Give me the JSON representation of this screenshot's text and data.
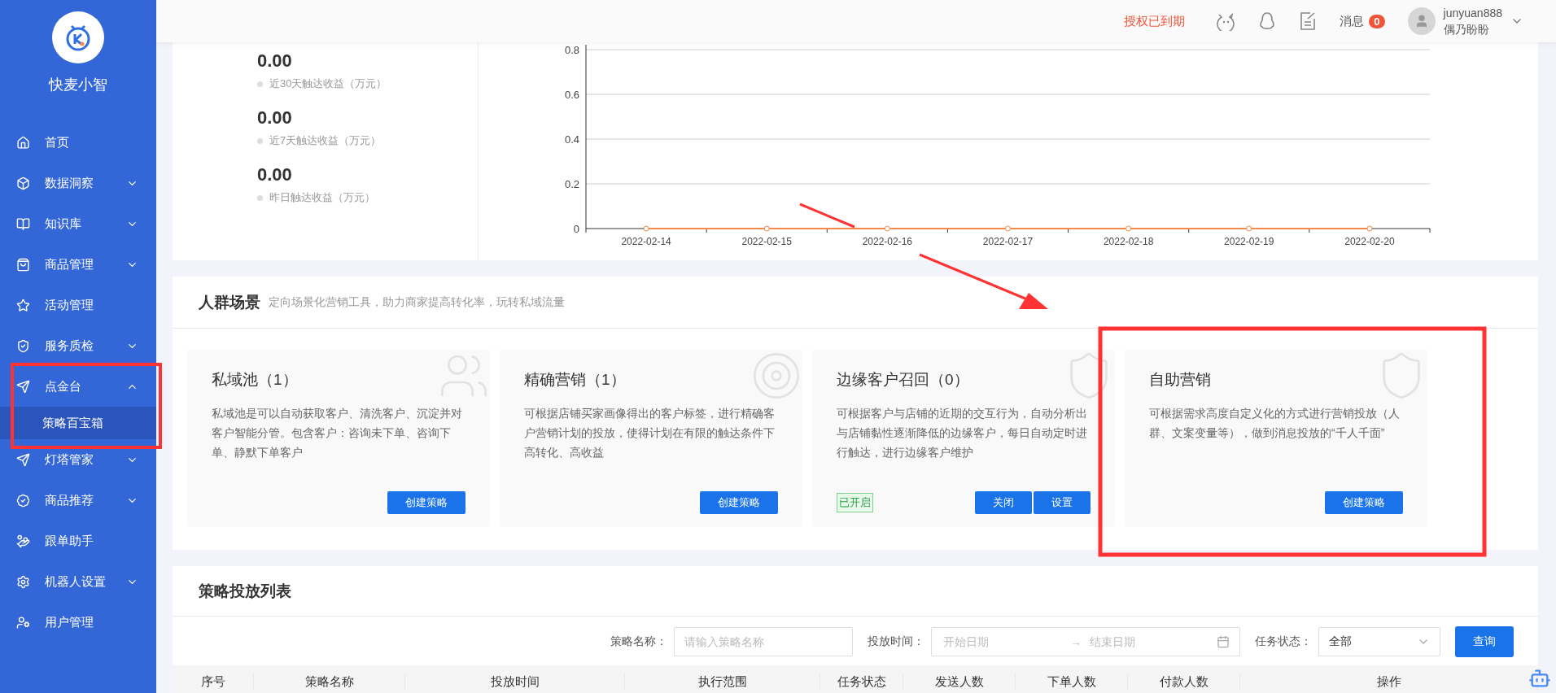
{
  "sidebar": {
    "brand": "快麦小智",
    "items": [
      {
        "label": "首页"
      },
      {
        "label": "数据洞察",
        "expanded": false
      },
      {
        "label": "知识库",
        "expanded": false
      },
      {
        "label": "商品管理",
        "expanded": false
      },
      {
        "label": "活动管理"
      },
      {
        "label": "服务质检",
        "expanded": false
      },
      {
        "label": "点金台",
        "expanded": true,
        "children": [
          {
            "label": "策略百宝箱",
            "selected": true
          }
        ]
      },
      {
        "label": "灯塔管家",
        "expanded": false
      },
      {
        "label": "商品推荐",
        "expanded": false
      },
      {
        "label": "跟单助手"
      },
      {
        "label": "机器人设置",
        "expanded": false
      },
      {
        "label": "用户管理"
      }
    ]
  },
  "header": {
    "license_notice": "授权已到期",
    "messages_label": "消息",
    "messages_count": "0",
    "username": "junyuan888",
    "nickname": "偶乃盼盼"
  },
  "stats": [
    {
      "value": "0.00",
      "label": "近30天触达收益（万元）"
    },
    {
      "value": "0.00",
      "label": "近7天触达收益（万元）"
    },
    {
      "value": "0.00",
      "label": "昨日触达收益（万元）"
    }
  ],
  "chart": {
    "chart_data": {
      "type": "line",
      "categories": [
        "2022-02-14",
        "2022-02-15",
        "2022-02-16",
        "2022-02-17",
        "2022-02-18",
        "2022-02-19",
        "2022-02-20"
      ],
      "series": [
        {
          "color": "#f5894a",
          "marker": "circle",
          "values": [
            0,
            0,
            0,
            0,
            0,
            0,
            0
          ]
        }
      ],
      "grid": true,
      "ylim": [
        0,
        0.8
      ],
      "yticks": [
        0,
        0.2,
        0.4,
        0.6,
        0.8
      ]
    }
  },
  "scenes": {
    "title": "人群场景",
    "subtitle": "定向场景化营销工具，助力商家提高转化率，玩转私域流量",
    "cards": [
      {
        "title": "私域池（1）",
        "description": "私域池是可以自动获取客户、清洗客户、沉淀并对客户智能分管。包含客户：咨询未下单、咨询下单、静默下单客户",
        "buttons": [
          "创建策略"
        ]
      },
      {
        "title": "精确营销（1）",
        "description": "可根据店铺买家画像得出的客户标签，进行精确客户营销计划的投放，使得计划在有限的触达条件下高转化、高收益",
        "buttons": [
          "创建策略"
        ]
      },
      {
        "title": "边缘客户召回（0）",
        "description": "可根据客户与店铺的近期的交互行为，自动分析出与店铺黏性逐渐降低的边缘客户，每日自动定时进行触达，进行边缘客户维护",
        "status": "已开启",
        "buttons": [
          "关闭",
          "设置"
        ]
      },
      {
        "title": "自助营销",
        "description": "可根据需求高度自定义化的方式进行营销投放（人群、文案变量等），做到消息投放的“千人千面”",
        "buttons": [
          "创建策略"
        ]
      }
    ]
  },
  "strategy_list": {
    "title": "策略投放列表",
    "filters": {
      "name_label": "策略名称：",
      "name_placeholder": "请输入策略名称",
      "time_label": "投放时间：",
      "start_placeholder": "开始日期",
      "range_separator": "→",
      "end_placeholder": "结束日期",
      "status_label": "任务状态：",
      "status_value": "全部",
      "search_button": "查询"
    },
    "columns": [
      "序号",
      "策略名称",
      "投放时间",
      "执行范围",
      "任务状态",
      "发送人数",
      "下单人数",
      "付款人数",
      "操作"
    ]
  }
}
